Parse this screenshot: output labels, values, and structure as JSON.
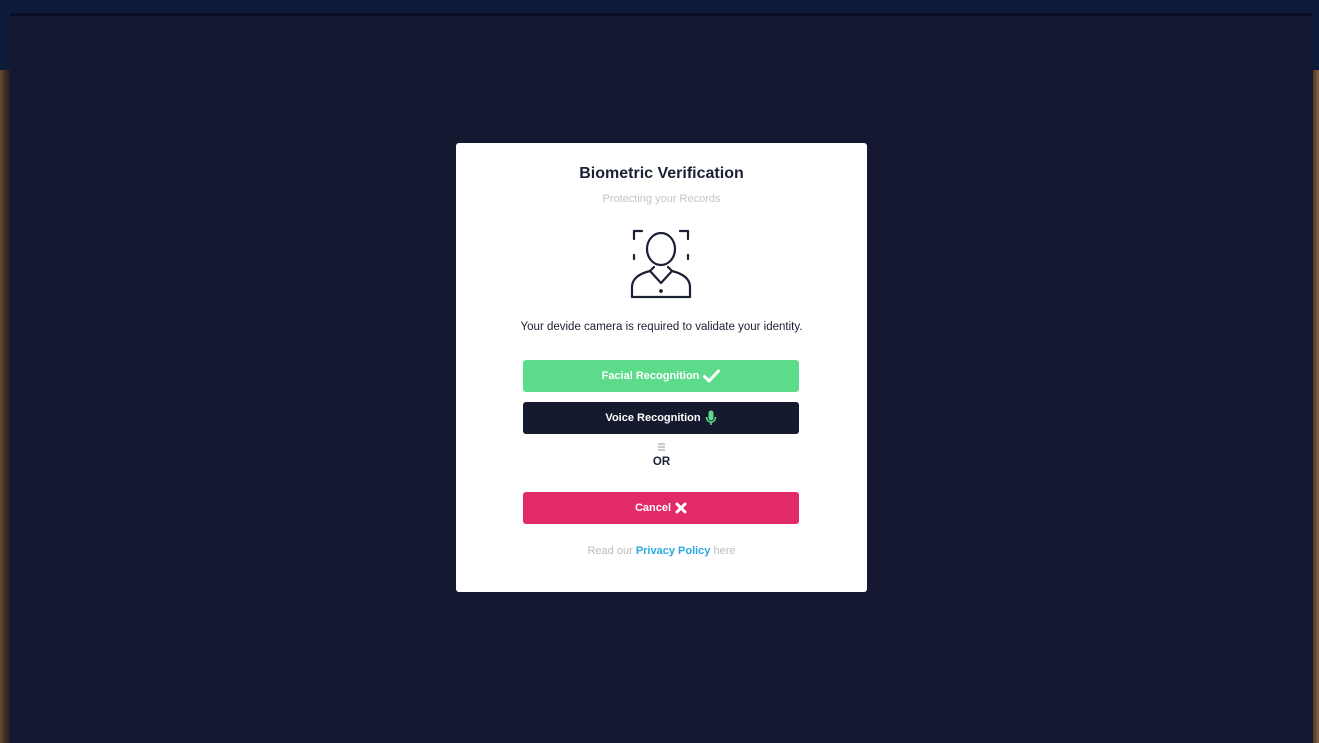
{
  "modal": {
    "title": "Biometric Verification",
    "subtitle": "Protecting your Records",
    "instruction": "Your devide camera is required to validate your identity.",
    "facial_button_label": "Facial Recognition",
    "voice_button_label": "Voice Recognition",
    "or_text": "OR",
    "cancel_button_label": "Cancel",
    "privacy": {
      "prefix": "Read our",
      "link_label": "Privacy Policy",
      "suffix": "here"
    }
  },
  "icons": {
    "face": "face-scan-icon",
    "facial": "checkmark-icon",
    "voice": "microphone-icon",
    "cancel": "close-icon"
  },
  "colors": {
    "facial_button": "#5cdb8b",
    "voice_button": "#151a2e",
    "cancel_button": "#e22a69",
    "link": "#2aa7e0",
    "overlay": "#141830"
  }
}
